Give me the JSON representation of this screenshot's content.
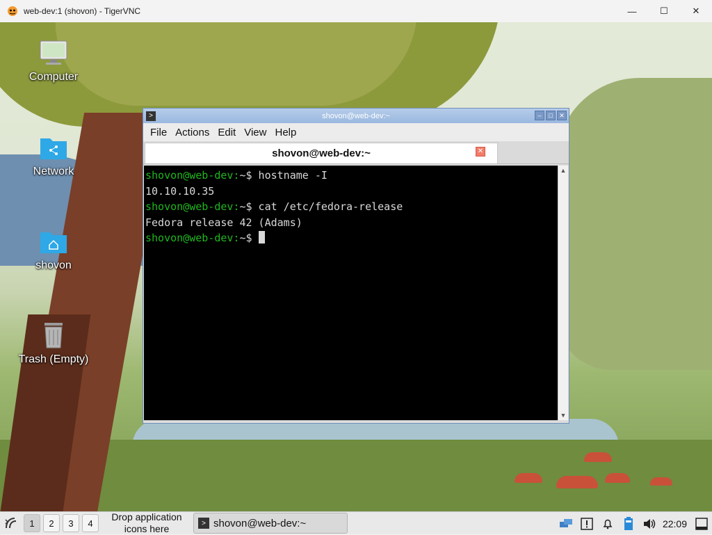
{
  "vnc_window": {
    "title": "web-dev:1 (shovon) - TigerVNC",
    "controls": {
      "minimize": "—",
      "maximize": "☐",
      "close": "✕"
    }
  },
  "desktop_icons": [
    {
      "label": "Computer",
      "icon": "computer-icon"
    },
    {
      "label": "Network",
      "icon": "network-folder-icon"
    },
    {
      "label": "shovon",
      "icon": "home-folder-icon"
    },
    {
      "label": "Trash (Empty)",
      "icon": "trash-icon"
    }
  ],
  "terminal": {
    "title": "shovon@web-dev:~",
    "menu": [
      "File",
      "Actions",
      "Edit",
      "View",
      "Help"
    ],
    "tab_label": "shovon@web-dev:~",
    "lines": [
      {
        "prompt": "shovon@web-dev:",
        "rest": "~$ hostname -I"
      },
      {
        "output": "10.10.10.35"
      },
      {
        "prompt": "shovon@web-dev:",
        "rest": "~$ cat /etc/fedora-release"
      },
      {
        "output": "Fedora release 42 (Adams)"
      },
      {
        "prompt": "shovon@web-dev:",
        "rest": "~$ "
      }
    ]
  },
  "taskbar": {
    "workspaces": [
      "1",
      "2",
      "3",
      "4"
    ],
    "active_workspace": "1",
    "drop_text": "Drop application icons here",
    "task_label": "shovon@web-dev:~",
    "clock": "22:09",
    "tray_icons": [
      "network-icon",
      "alert-icon",
      "notification-bell-icon",
      "battery-icon",
      "volume-icon",
      "show-desktop-icon"
    ]
  },
  "colors": {
    "prompt_green": "#1fb71f",
    "terminal_bg": "#000000",
    "terminal_title": "#9ab8df"
  }
}
